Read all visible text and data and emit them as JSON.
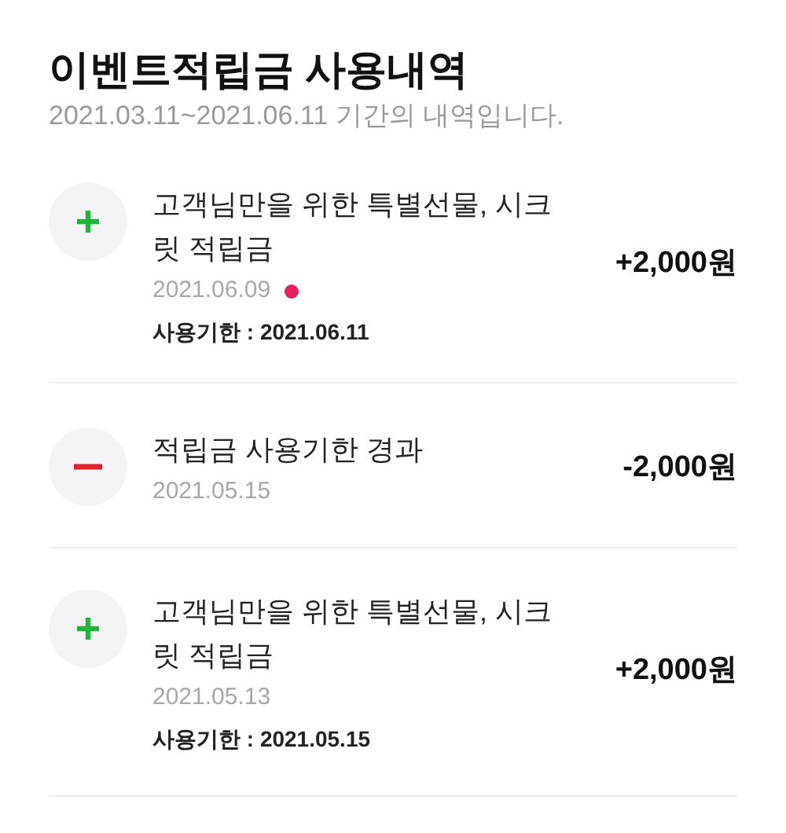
{
  "header": {
    "title": "이벤트적립금 사용내역",
    "subtitle": "2021.03.11~2021.06.11 기간의 내역입니다."
  },
  "entries": [
    {
      "kind": "plus",
      "title": "고객님만을 위한 특별선물, 시크릿 적립금",
      "date": "2021.06.09",
      "new": true,
      "expiry": "사용기한 : 2021.06.11",
      "amount": "+2,000원"
    },
    {
      "kind": "minus",
      "title": "적립금 사용기한 경과",
      "date": "2021.05.15",
      "new": false,
      "amount": "-2,000원"
    },
    {
      "kind": "plus",
      "title": "고객님만을 위한 특별선물, 시크릿 적립금",
      "date": "2021.05.13",
      "new": false,
      "expiry": "사용기한 : 2021.05.15",
      "amount": "+2,000원"
    }
  ]
}
